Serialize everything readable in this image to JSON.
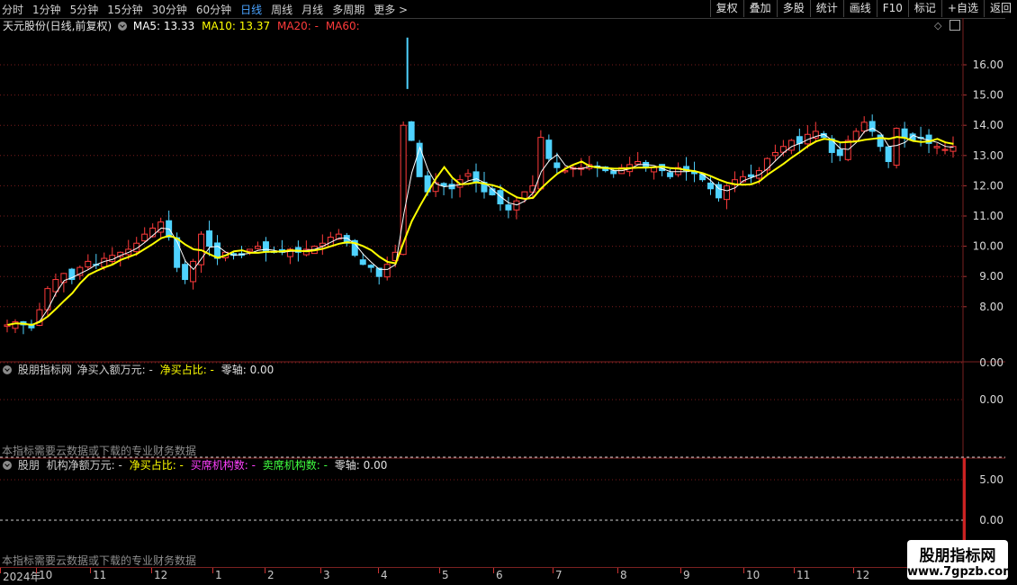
{
  "toolbar": {
    "periods": [
      "分时",
      "1分钟",
      "5分钟",
      "15分钟",
      "30分钟",
      "60分钟",
      "日线",
      "周线",
      "月线",
      "多周期",
      "更多 >"
    ],
    "active_period": "日线",
    "tools": [
      "复权",
      "叠加",
      "多股",
      "统计",
      "画线",
      "F10",
      "标记",
      "+自选",
      "返回"
    ]
  },
  "main_panel": {
    "stock": "天元股份(日线,前复权)",
    "ma5": "MA5: 13.33",
    "ma10": "MA10: 13.37",
    "ma20": "MA20: -",
    "ma60": "MA60:",
    "y_ticks": [
      "16.00",
      "15.00",
      "14.00",
      "13.00",
      "12.00",
      "11.00",
      "10.00",
      "9.00",
      "8.00"
    ]
  },
  "panel2": {
    "name": "股朋指标网",
    "net_buy": "净买入额万元: -",
    "ratio": "净买占比: -",
    "zero": "零轴: 0.00",
    "y_ticks": [
      "0.00",
      "0.00"
    ],
    "note": "本指标需要云数据或下载的专业财务数据"
  },
  "panel3": {
    "name": "股朋",
    "net": "机构净额万元: -",
    "ratio": "净买占比: -",
    "buy": "买席机构数: -",
    "sell": "卖席机构数: -",
    "zero": "零轴: 0.00",
    "y_ticks": [
      "5.00",
      "0.00"
    ],
    "note": "本指标需要云数据或下载的专业财务数据"
  },
  "date_axis": [
    "2024年",
    "10",
    "11",
    "12",
    "1",
    "2",
    "3",
    "4",
    "5",
    "6",
    "7",
    "8",
    "9",
    "10",
    "11",
    "12"
  ],
  "watermark": {
    "line1": "股朋指标网",
    "line2": "www.7gpzb.com"
  },
  "colors": {
    "up": "#ff3b3b",
    "down": "#4fd2ff",
    "ma5": "#ffffff",
    "ma10": "#ffff00",
    "ma20": "#ff3b3b",
    "grid": "#7a1c1c",
    "active": "#4aa3ff"
  },
  "chart_data": {
    "type": "candlestick",
    "y_range": [
      7.0,
      17.0
    ],
    "close_path": [
      7.4,
      7.5,
      7.4,
      7.3,
      7.9,
      8.6,
      8.9,
      9.1,
      8.9,
      9.3,
      9.5,
      9.4,
      9.6,
      9.7,
      9.8,
      9.9,
      10.1,
      10.4,
      10.6,
      10.8,
      10.3,
      9.3,
      8.9,
      9.5,
      10.4,
      10.0,
      9.6,
      9.8,
      9.7,
      9.7,
      9.9,
      10.0,
      9.8,
      9.8,
      9.8,
      9.9,
      9.8,
      9.9,
      10.0,
      10.1,
      10.3,
      10.4,
      10.1,
      9.7,
      9.4,
      9.3,
      9.0,
      9.4,
      9.8,
      14.0,
      13.5,
      12.3,
      11.8,
      12.1,
      12.0,
      11.9,
      12.2,
      12.4,
      12.1,
      11.8,
      11.7,
      11.4,
      11.2,
      11.5,
      11.8,
      12.0,
      13.6,
      12.9,
      12.6,
      12.5,
      12.6,
      12.6,
      12.7,
      12.6,
      12.5,
      12.4,
      12.6,
      12.7,
      12.8,
      12.6,
      12.6,
      12.5,
      12.3,
      12.6,
      12.5,
      12.4,
      12.2,
      11.9,
      11.6,
      12.0,
      12.2,
      12.3,
      12.3,
      12.5,
      12.9,
      13.1,
      13.3,
      13.5,
      13.4,
      13.7,
      13.8,
      13.6,
      13.1,
      13.0,
      13.5,
      13.8,
      14.1,
      13.8,
      13.3,
      12.8,
      13.9,
      13.6,
      13.5,
      13.6,
      13.4,
      13.3,
      13.2,
      13.3
    ]
  }
}
